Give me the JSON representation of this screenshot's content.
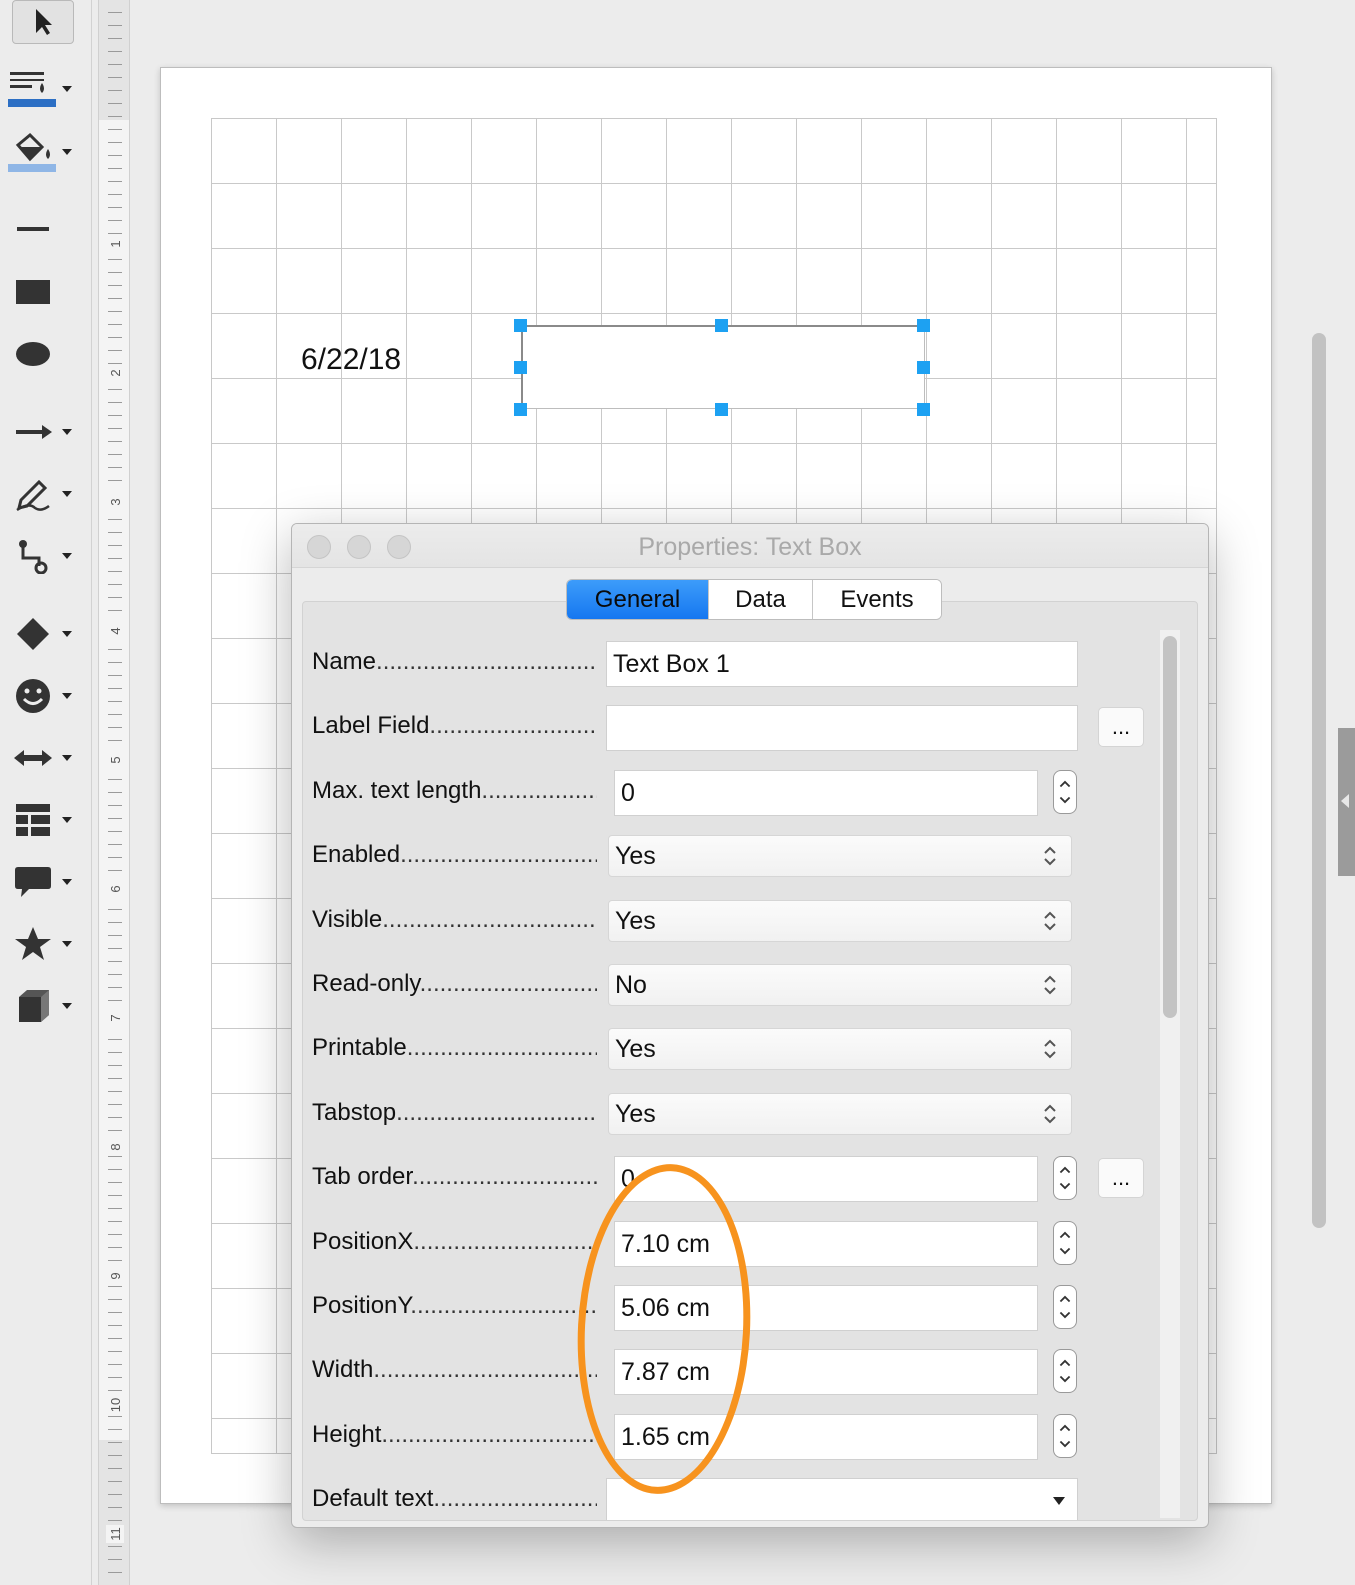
{
  "toolbar": {
    "tools": [
      {
        "icon": "select-arrow-icon",
        "dropdown": false
      },
      {
        "icon": "line-color-icon",
        "dropdown": true
      },
      {
        "icon": "fill-color-icon",
        "dropdown": true
      },
      {
        "icon": "line-icon",
        "dropdown": false
      },
      {
        "icon": "rectangle-icon",
        "dropdown": false
      },
      {
        "icon": "ellipse-icon",
        "dropdown": false
      },
      {
        "icon": "arrow-line-icon",
        "dropdown": true
      },
      {
        "icon": "freeform-pencil-icon",
        "dropdown": true
      },
      {
        "icon": "connector-icon",
        "dropdown": true
      },
      {
        "icon": "diamond-icon",
        "dropdown": true
      },
      {
        "icon": "smiley-icon",
        "dropdown": true
      },
      {
        "icon": "double-arrow-icon",
        "dropdown": true
      },
      {
        "icon": "table-icon",
        "dropdown": true
      },
      {
        "icon": "callout-icon",
        "dropdown": true
      },
      {
        "icon": "star-icon",
        "dropdown": true
      },
      {
        "icon": "cube-icon",
        "dropdown": true
      }
    ]
  },
  "ruler": {
    "numbers": [
      "1",
      "2",
      "3",
      "4",
      "5",
      "6",
      "7",
      "8",
      "9",
      "10",
      "11"
    ]
  },
  "canvas": {
    "date_text": "6/22/18"
  },
  "dialog": {
    "title": "Properties: Text Box",
    "tabs": [
      {
        "label": "General",
        "active": true
      },
      {
        "label": "Data",
        "active": false
      },
      {
        "label": "Events",
        "active": false
      }
    ],
    "rows": [
      {
        "label": "Name",
        "kind": "text",
        "value": "Text Box 1"
      },
      {
        "label": "Label Field",
        "kind": "text-dots",
        "value": ""
      },
      {
        "label": "Max. text length",
        "kind": "spin",
        "value": "0"
      },
      {
        "label": "Enabled",
        "kind": "select",
        "value": "Yes"
      },
      {
        "label": "Visible",
        "kind": "select",
        "value": "Yes"
      },
      {
        "label": "Read-only",
        "kind": "select",
        "value": "No"
      },
      {
        "label": "Printable",
        "kind": "select",
        "value": "Yes"
      },
      {
        "label": "Tabstop",
        "kind": "select",
        "value": "Yes"
      },
      {
        "label": "Tab order",
        "kind": "spin-dots",
        "value": "0"
      },
      {
        "label": "PositionX",
        "kind": "spin",
        "value": "7.10 cm"
      },
      {
        "label": "PositionY",
        "kind": "spin",
        "value": "5.06 cm"
      },
      {
        "label": "Width",
        "kind": "spin",
        "value": "7.87 cm"
      },
      {
        "label": "Height",
        "kind": "spin",
        "value": "1.65 cm"
      },
      {
        "label": "Default text",
        "kind": "dropdown",
        "value": ""
      }
    ],
    "dots_label": "...",
    "annotation_color": "#f7931e"
  }
}
